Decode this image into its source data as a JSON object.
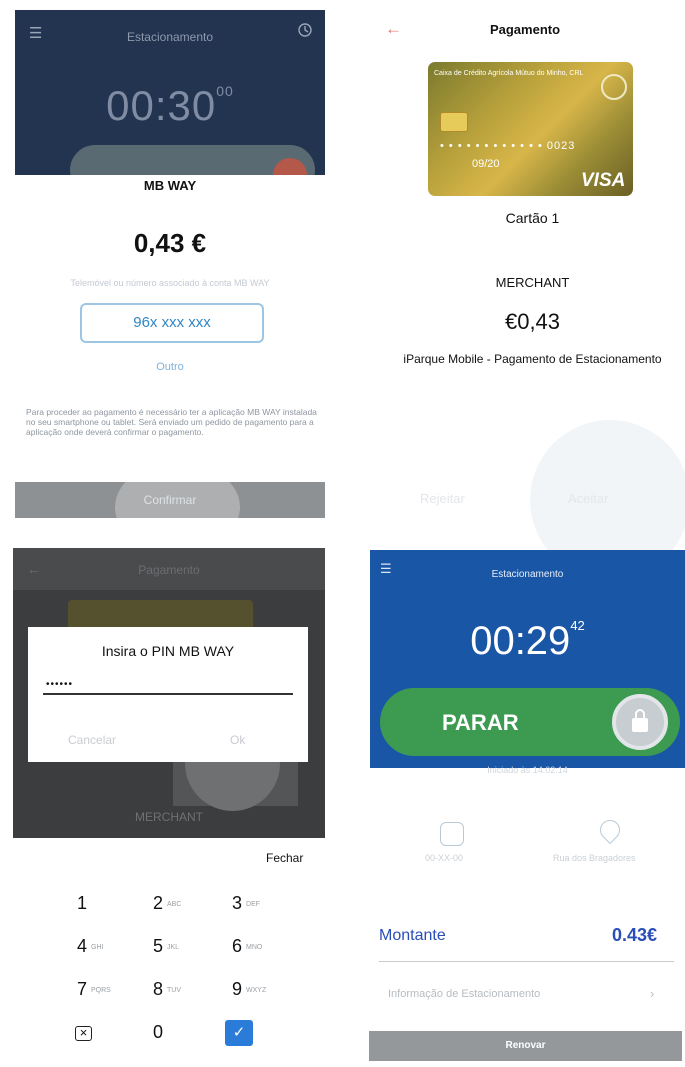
{
  "panel_mbway": {
    "header_title": "Estacionamento",
    "timer_main": "00:30",
    "timer_seconds": "00",
    "brand": "MB WAY",
    "amount": "0,43 €",
    "hint": "Telemóvel ou número associado à conta MB WAY",
    "phone": "96x xxx xxx",
    "other_link": "Outro",
    "note": "Para proceder ao pagamento é necessário ter a aplicação MB WAY instalada no seu smartphone ou tablet. Será enviado um pedido de pagamento para a aplicação onde deverá confirmar o pagamento.",
    "confirm_label": "Confirmar"
  },
  "panel_payment": {
    "title": "Pagamento",
    "card_bank": "Caixa de Crédito Agrícola Mútuo do Minho, CRL",
    "card_number": "• • • • • • • • • • • • 0023",
    "card_expiry": "09/20",
    "card_network": "VISA",
    "card_name": "Cartão 1",
    "merchant": "MERCHANT",
    "amount": "€0,43",
    "description": "iParque Mobile - Pagamento de Estacionamento",
    "reject_label": "Rejeitar",
    "accept_label": "Aceitar"
  },
  "panel_pin": {
    "bg_title": "Pagamento",
    "bg_merchant": "MERCHANT",
    "prompt": "Insira o PIN MB WAY",
    "pin_masked": "••••••",
    "cancel_label": "Cancelar",
    "ok_label": "Ok",
    "close_label": "Fechar",
    "keys": [
      {
        "digit": "1",
        "letters": ""
      },
      {
        "digit": "2",
        "letters": "ABC"
      },
      {
        "digit": "3",
        "letters": "DEF"
      },
      {
        "digit": "4",
        "letters": "GHI"
      },
      {
        "digit": "5",
        "letters": "JKL"
      },
      {
        "digit": "6",
        "letters": "MNO"
      },
      {
        "digit": "7",
        "letters": "PQRS"
      },
      {
        "digit": "8",
        "letters": "TUV"
      },
      {
        "digit": "9",
        "letters": "WXYZ"
      },
      {
        "digit": "0",
        "letters": ""
      }
    ]
  },
  "panel_parking": {
    "header_title": "Estacionamento",
    "timer_main": "00:29",
    "timer_seconds": "42",
    "stop_label": "PARAR",
    "since_text": "Iniciado às 14:02:14",
    "vehicle_label": "00-XX-00",
    "zone_label": "Rua dos Bragadores",
    "amount_label": "Montante",
    "amount_value": "0.43€",
    "info_label": "Informação de Estacionamento",
    "renew_label": "Renovar"
  },
  "colors": {
    "mbway_header": "#22344f",
    "parking_header": "#1a56a6",
    "stop_button": "#3c9a51",
    "accent_blue": "#2a4eb8",
    "check_key": "#2b7bd9"
  }
}
